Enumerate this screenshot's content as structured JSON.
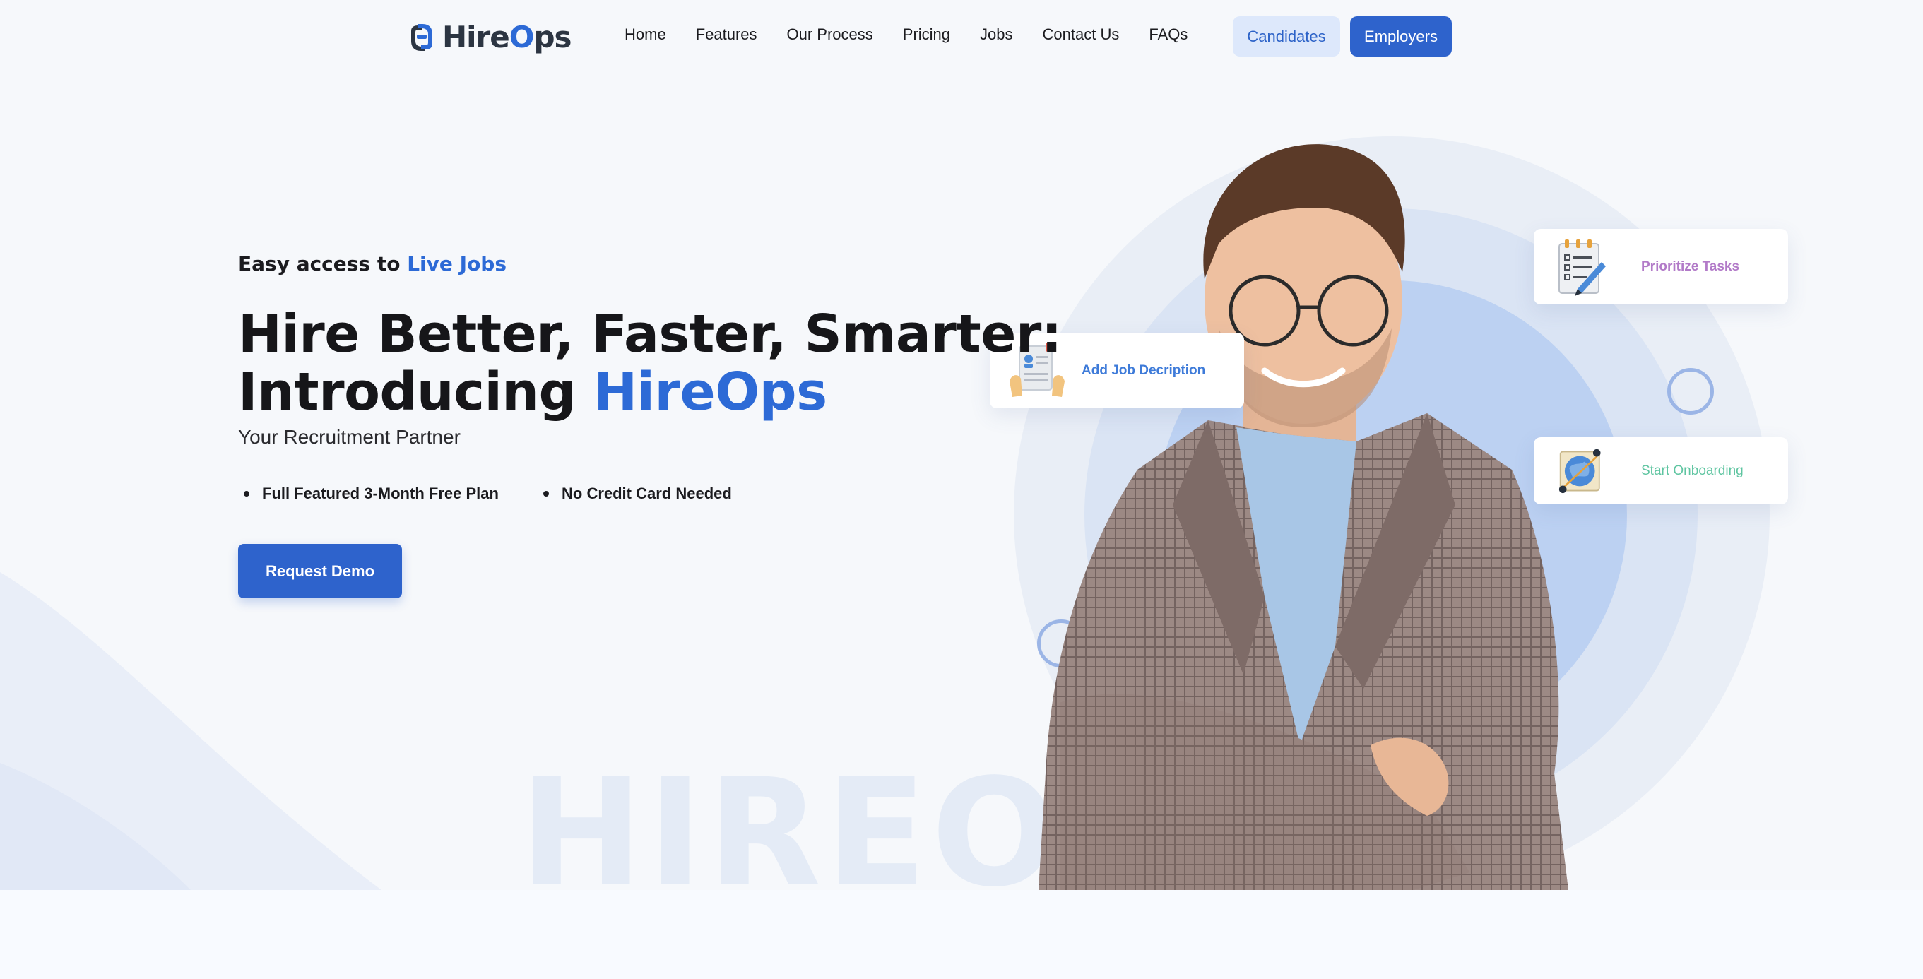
{
  "brand": {
    "name_prefix": "Hire",
    "name_o": "O",
    "name_suffix": "ps",
    "accent_color": "#2d6ad6",
    "primary_button_color": "#2e63cc"
  },
  "nav": {
    "items": [
      {
        "label": "Home"
      },
      {
        "label": "Features"
      },
      {
        "label": "Our Process"
      },
      {
        "label": "Pricing"
      },
      {
        "label": "Jobs"
      },
      {
        "label": "Contact Us"
      },
      {
        "label": "FAQs"
      }
    ],
    "candidates_label": "Candidates",
    "employers_label": "Employers"
  },
  "hero": {
    "eyebrow_prefix": "Easy access to",
    "eyebrow_accent": "Live Jobs",
    "title_line1": "Hire Better, Faster, Smarter:",
    "title_line2_prefix": "Introducing",
    "title_line2_accent": "HireOps",
    "subtitle": "Your Recruitment Partner",
    "bullets": [
      {
        "text": "Full Featured 3-Month Free Plan"
      },
      {
        "text": "No Credit Card Needed"
      }
    ],
    "cta_label": "Request Demo",
    "watermark": "HIREOPS"
  },
  "cards": [
    {
      "label": "Add Job Decription",
      "icon": "job-description-icon",
      "color": "#3e7bd9"
    },
    {
      "label": "Prioritize Tasks",
      "icon": "task-checklist-icon",
      "color": "#b27ac8"
    },
    {
      "label": "Start Onboarding",
      "icon": "onboarding-globe-icon",
      "color": "#5fc5a1"
    }
  ]
}
